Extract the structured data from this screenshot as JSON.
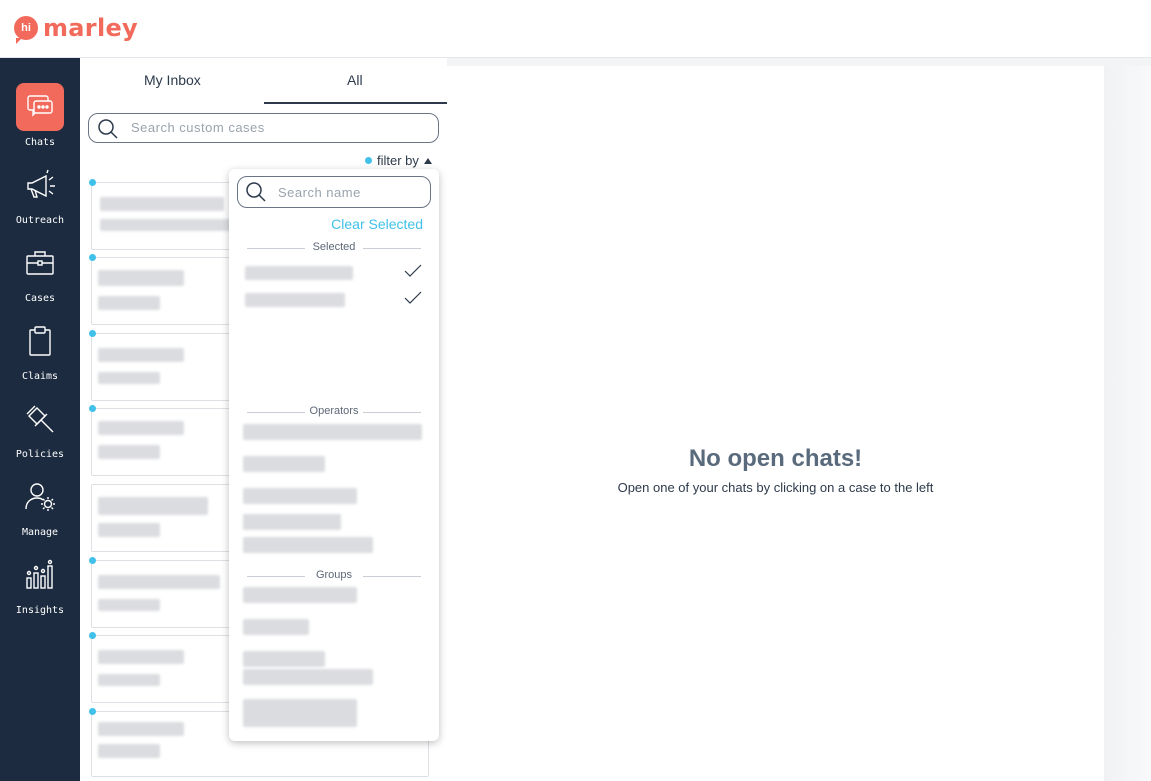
{
  "app": {
    "logo_badge": "hi",
    "logo_text": "marley"
  },
  "colors": {
    "brand": "#f26a5b",
    "sidebar": "#1c2b3f",
    "accent": "#41c0ea"
  },
  "nav": [
    {
      "label": "Chats",
      "icon": "chat-bubble-icon",
      "active": true
    },
    {
      "label": "Outreach",
      "icon": "megaphone-icon",
      "active": false
    },
    {
      "label": "Cases",
      "icon": "briefcase-icon",
      "active": false
    },
    {
      "label": "Claims",
      "icon": "clipboard-icon",
      "active": false
    },
    {
      "label": "Policies",
      "icon": "gavel-icon",
      "active": false
    },
    {
      "label": "Manage",
      "icon": "user-gear-icon",
      "active": false
    },
    {
      "label": "Insights",
      "icon": "bar-chart-icon",
      "active": false
    }
  ],
  "tabs": {
    "my_inbox": "My Inbox",
    "all": "All",
    "active": "All"
  },
  "search": {
    "placeholder": "Search custom cases"
  },
  "filter": {
    "label": "filter by"
  },
  "dropdown": {
    "search_placeholder": "Search name",
    "clear_label": "Clear Selected",
    "selected_header": "Selected",
    "operators_header": "Operators",
    "groups_header": "Groups"
  },
  "empty_state": {
    "title": "No open chats!",
    "subtitle": "Open one of your chats by clicking on a case to the left"
  }
}
